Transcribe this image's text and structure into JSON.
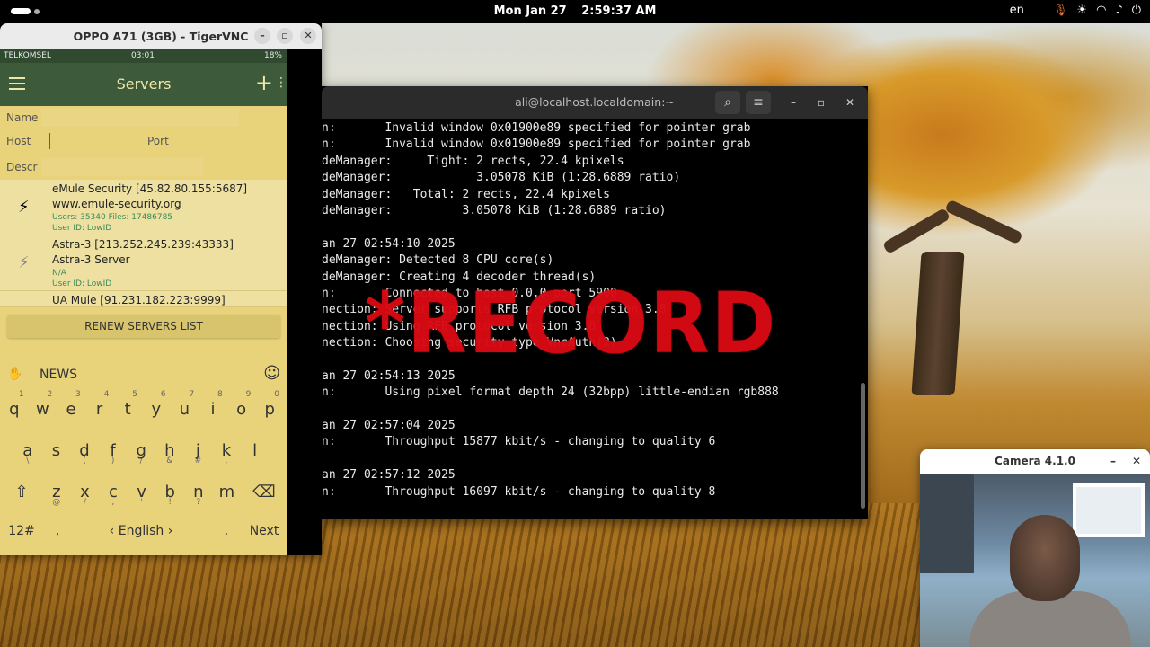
{
  "topbar": {
    "date": "Mon Jan 27",
    "time": "2:59:37 AM",
    "lang": "en",
    "icons": [
      "microphone-icon",
      "brightness-icon",
      "wifi-icon",
      "volume-icon",
      "power-icon"
    ]
  },
  "vnc": {
    "title": "OPPO A71 (3GB) - TigerVNC",
    "phone": {
      "status": {
        "carrier": "TELKOMSEL",
        "time": "03:01",
        "battery": "18%"
      },
      "appbar_title": "Servers",
      "form": {
        "name_label": "Name",
        "host_label": "Host",
        "port_label": "Port",
        "descr_label": "Descr"
      },
      "servers": [
        {
          "name": "eMule Security [45.82.80.155:5687]",
          "desc": "www.emule-security.org",
          "stats": "Users: 35340 Files: 17486785",
          "userid": "User ID: LowID"
        },
        {
          "name": "Astra-3 [213.252.245.239:43333]",
          "desc": "Astra-3 Server",
          "stats": "N/A",
          "userid": "User ID: LowID"
        },
        {
          "name": "UA Mule [91.231.182.223:9999]"
        }
      ],
      "renew_label": "RENEW SERVERS LIST",
      "keyboard": {
        "suggestion": "NEWS",
        "row1": [
          {
            "k": "q",
            "s": "1"
          },
          {
            "k": "w",
            "s": "2"
          },
          {
            "k": "e",
            "s": "3"
          },
          {
            "k": "r",
            "s": "4"
          },
          {
            "k": "t",
            "s": "5"
          },
          {
            "k": "y",
            "s": "6"
          },
          {
            "k": "u",
            "s": "7"
          },
          {
            "k": "i",
            "s": "8"
          },
          {
            "k": "o",
            "s": "9"
          },
          {
            "k": "p",
            "s": "0"
          }
        ],
        "row2": [
          {
            "k": "a",
            "b": "\\"
          },
          {
            "k": "s",
            "b": ""
          },
          {
            "k": "d",
            "b": "("
          },
          {
            "k": "f",
            "b": ")"
          },
          {
            "k": "g",
            "b": "/"
          },
          {
            "k": "h",
            "b": "&"
          },
          {
            "k": "j",
            "b": "#"
          },
          {
            "k": "k",
            "b": ","
          },
          {
            "k": "l",
            "b": ""
          }
        ],
        "row3": [
          {
            "k": "z",
            "b": "@"
          },
          {
            "k": "x",
            "b": "/"
          },
          {
            "k": "c",
            "b": ","
          },
          {
            "k": "v",
            "b": "'"
          },
          {
            "k": "b",
            "b": "!"
          },
          {
            "k": "n",
            "b": "?"
          },
          {
            "k": "m",
            "b": ""
          }
        ],
        "symbols_label": "12#",
        "space_label": "English",
        "period_label": ".",
        "next_label": "Next"
      }
    }
  },
  "terminal": {
    "title": "ali@localhost.localdomain:~",
    "lines": [
      "n:       Invalid window 0x01900e89 specified for pointer grab",
      "n:       Invalid window 0x01900e89 specified for pointer grab",
      "deManager:     Tight: 2 rects, 22.4 kpixels",
      "deManager:            3.05078 KiB (1:28.6889 ratio)",
      "deManager:   Total: 2 rects, 22.4 kpixels",
      "deManager:          3.05078 KiB (1:28.6889 ratio)",
      "",
      "an 27 02:54:10 2025",
      "deManager: Detected 8 CPU core(s)",
      "deManager: Creating 4 decoder thread(s)",
      "n:       Connected to host 0.0.0 port 5900",
      "nection: Server supports RFB protocol version 3.8",
      "nection: Using RFB protocol version 3.8",
      "nection: Choosing security type VncAuth(2)",
      "",
      "an 27 02:54:13 2025",
      "n:       Using pixel format depth 24 (32bpp) little-endian rgb888",
      "",
      "an 27 02:57:04 2025",
      "n:       Throughput 15877 kbit/s - changing to quality 6",
      "",
      "an 27 02:57:12 2025",
      "n:       Throughput 16097 kbit/s - changing to quality 8"
    ]
  },
  "overlay": {
    "record_text": "*RECORD"
  },
  "camera": {
    "title": "Camera 4.1.0"
  }
}
